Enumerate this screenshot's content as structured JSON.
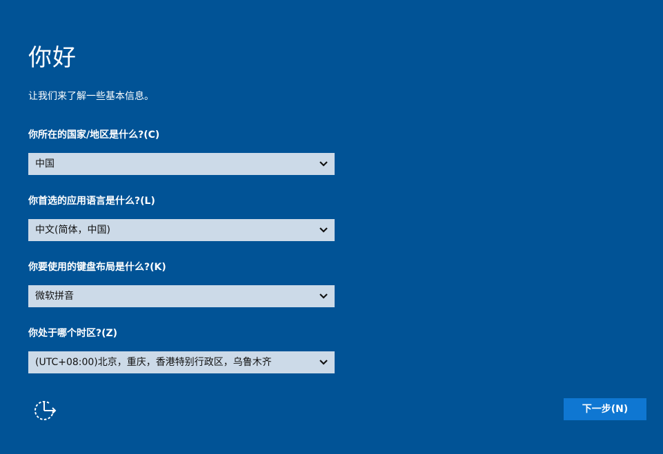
{
  "header": {
    "title": "你好",
    "subtitle": "让我们来了解一些基本信息。"
  },
  "fields": [
    {
      "label": "你所在的国家/地区是什么?(C)",
      "value": "中国"
    },
    {
      "label": "你首选的应用语言是什么?(L)",
      "value": "中文(简体，中国)"
    },
    {
      "label": "你要使用的键盘布局是什么?(K)",
      "value": "微软拼音"
    },
    {
      "label": "你处于哪个时区?(Z)",
      "value": "(UTC+08:00)北京，重庆，香港特别行政区，乌鲁木齐"
    }
  ],
  "footer": {
    "accessibility_icon": "ease-of-access-icon",
    "next_label": "下一步(N)"
  },
  "colors": {
    "background": "#015396",
    "select_background": "#ccdae8",
    "button_background": "#0f77d2",
    "text": "#ffffff"
  }
}
